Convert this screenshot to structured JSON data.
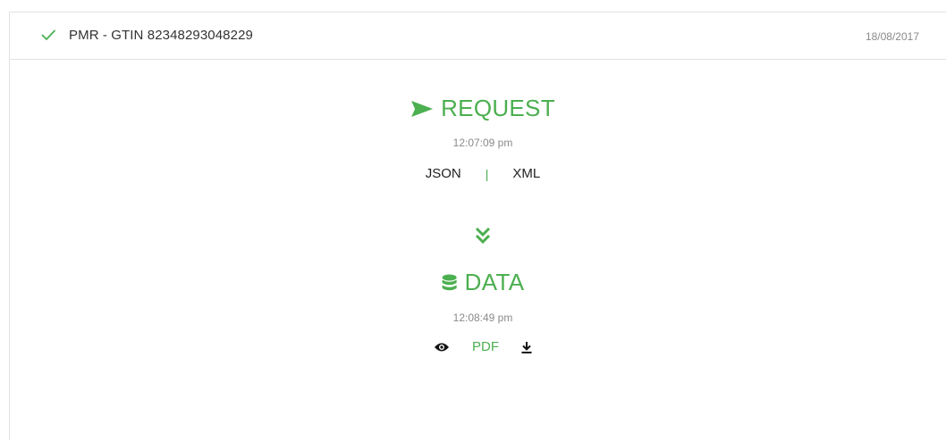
{
  "header": {
    "title": "PMR - GTIN 82348293048229",
    "date": "18/08/2017"
  },
  "request": {
    "title": "REQUEST",
    "time": "12:07:09 pm",
    "links": {
      "json": "JSON",
      "separator": "|",
      "xml": "XML"
    }
  },
  "data_section": {
    "title": "DATA",
    "time": "12:08:49 pm",
    "pdf_label": "PDF"
  },
  "icons": {
    "status": "check-icon",
    "request": "send-icon",
    "flow": "double-chevron-down-icon",
    "data": "database-icon",
    "view": "eye-icon",
    "download": "download-icon"
  },
  "colors": {
    "accent": "#4caf50",
    "text": "#333333",
    "muted": "#8a8a8a",
    "border": "#e2e2e2"
  }
}
